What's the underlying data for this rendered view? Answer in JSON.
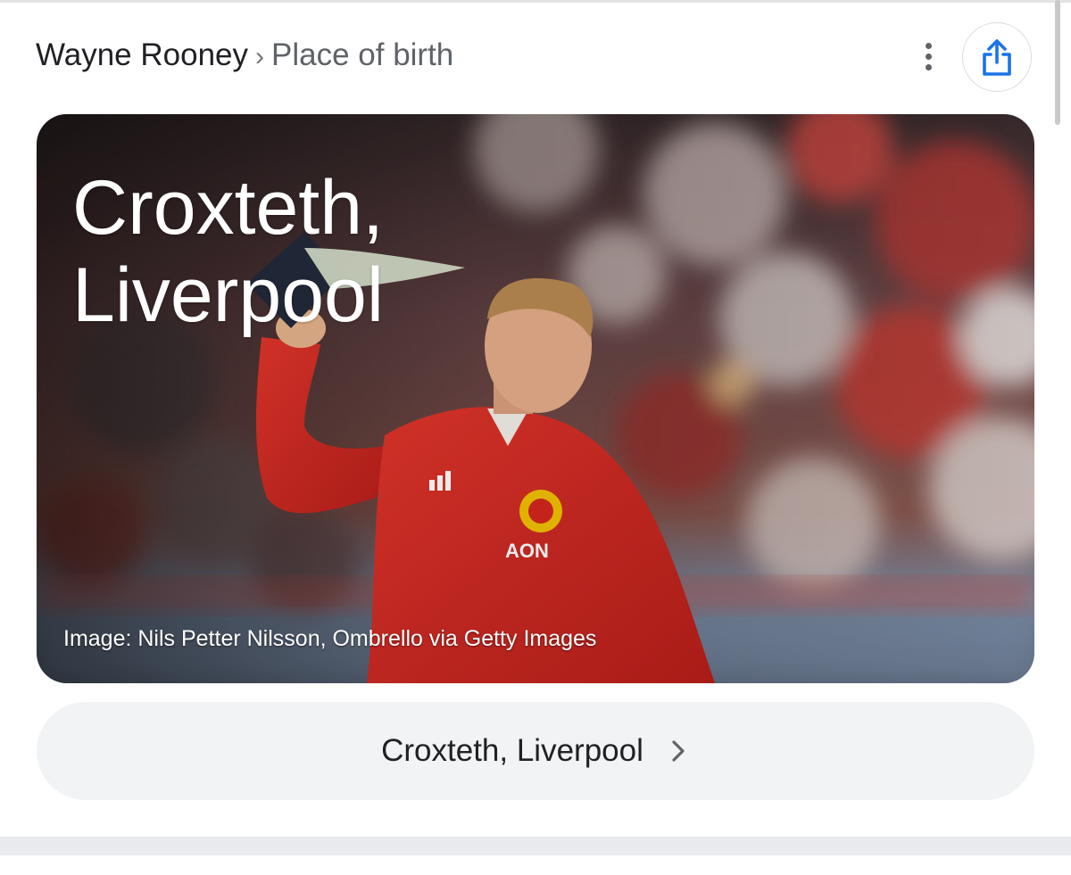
{
  "breadcrumb": {
    "entity": "Wayne Rooney",
    "separator": "›",
    "attribute": "Place of birth"
  },
  "actions": {
    "more_icon": "more-vert-icon",
    "share_icon": "share-icon",
    "accent_color": "#1a73e8"
  },
  "hero": {
    "title": "Croxteth, Liverpool",
    "image_credit": "Image: Nils Petter Nilsson, Ombrello via Getty Images",
    "jersey_text": "AON"
  },
  "answer": {
    "label": "Croxteth, Liverpool",
    "chevron_icon": "chevron-right-icon"
  }
}
